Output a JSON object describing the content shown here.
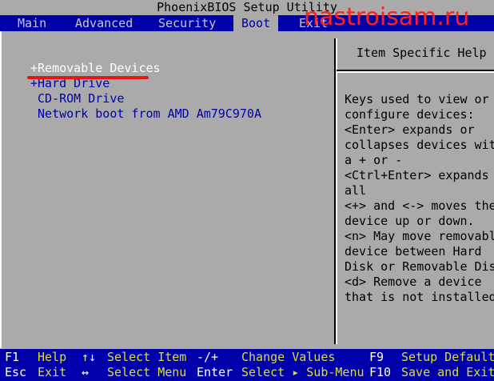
{
  "title": "PhoenixBIOS Setup Utility",
  "watermark": "nastroisam.ru",
  "tabs": [
    {
      "label": "Main"
    },
    {
      "label": "Advanced"
    },
    {
      "label": "Security"
    },
    {
      "label": "Boot"
    },
    {
      "label": "Exit"
    }
  ],
  "boot_items": [
    {
      "label": "+Removable Devices"
    },
    {
      "label": "+Hard Drive"
    },
    {
      "label": " CD-ROM Drive"
    },
    {
      "label": " Network boot from AMD Am79C970A"
    }
  ],
  "help": {
    "title": "Item Specific Help",
    "lines": [
      "Keys used to view or",
      "configure devices:",
      "<Enter> expands or",
      "collapses devices with",
      "a + or -",
      "<Ctrl+Enter> expands",
      "all",
      "<+> and <-> moves the",
      "device up or down.",
      "<n> May move removable",
      "device between Hard",
      "Disk or Removable Disk",
      "<d> Remove a device",
      "that is not installed."
    ]
  },
  "footer": {
    "row1": [
      {
        "key": "F1",
        "desc": "Help"
      },
      {
        "key": "↑↓",
        "desc": "Select Item"
      },
      {
        "key": "-/+",
        "desc": "Change Values"
      },
      {
        "key": "F9",
        "desc": "Setup Defaults"
      }
    ],
    "row2": [
      {
        "key": "Esc",
        "desc": "Exit"
      },
      {
        "key": "↔",
        "desc": "Select Menu"
      },
      {
        "key": "Enter",
        "desc": "Select ▸ Sub-Menu"
      },
      {
        "key": "F10",
        "desc": "Save and Exit"
      }
    ]
  },
  "colors": {
    "menubar": "#0000aa",
    "background": "#aaaaaa",
    "selected_text": "#ffffff",
    "item_text": "#0000aa",
    "footer_desc": "#dcdc40",
    "annotation": "#e01818"
  }
}
